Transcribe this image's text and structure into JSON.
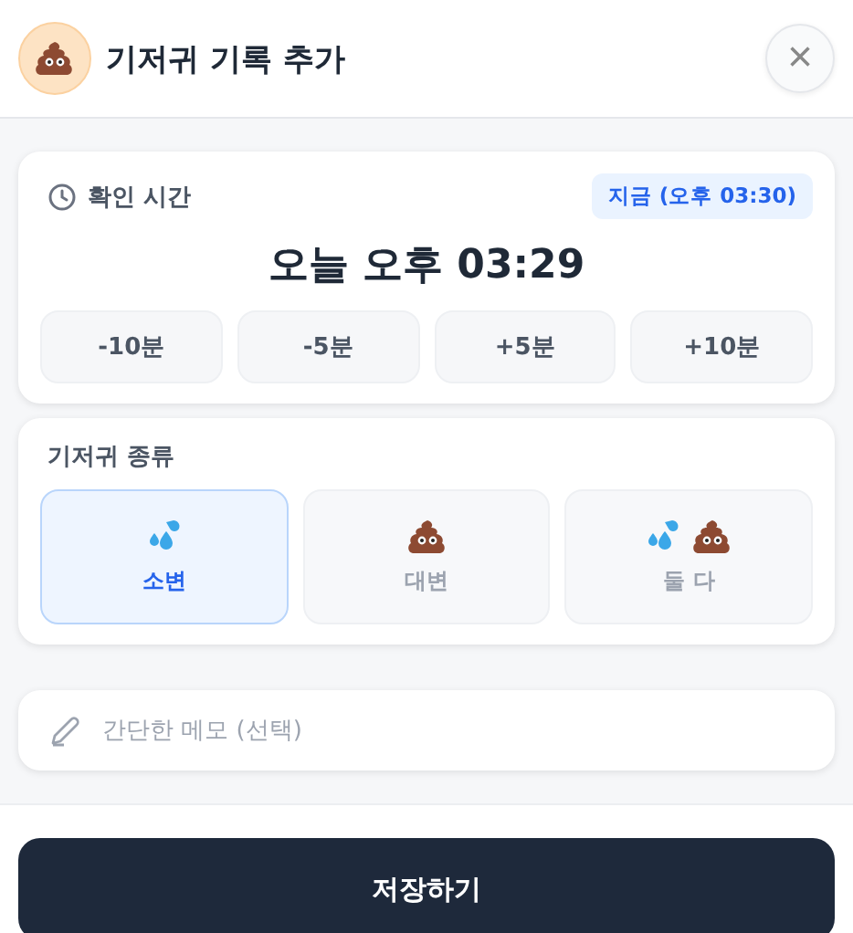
{
  "header": {
    "title": "기저귀 기록 추가",
    "close": "×"
  },
  "time_card": {
    "label": "확인 시간",
    "now_button": "지금 (오후 03:30)",
    "value": "오늘 오후 03:29",
    "adjust_buttons": [
      "-10분",
      "-5분",
      "+5분",
      "+10분"
    ]
  },
  "type_card": {
    "label": "기저귀 종류",
    "options": [
      {
        "kind": "urine",
        "label": "소변",
        "selected": true
      },
      {
        "kind": "stool",
        "label": "대변",
        "selected": false
      },
      {
        "kind": "both",
        "label": "둘 다",
        "selected": false
      }
    ]
  },
  "memo": {
    "placeholder": "간단한 메모 (선택)"
  },
  "save_button": "저장하기"
}
